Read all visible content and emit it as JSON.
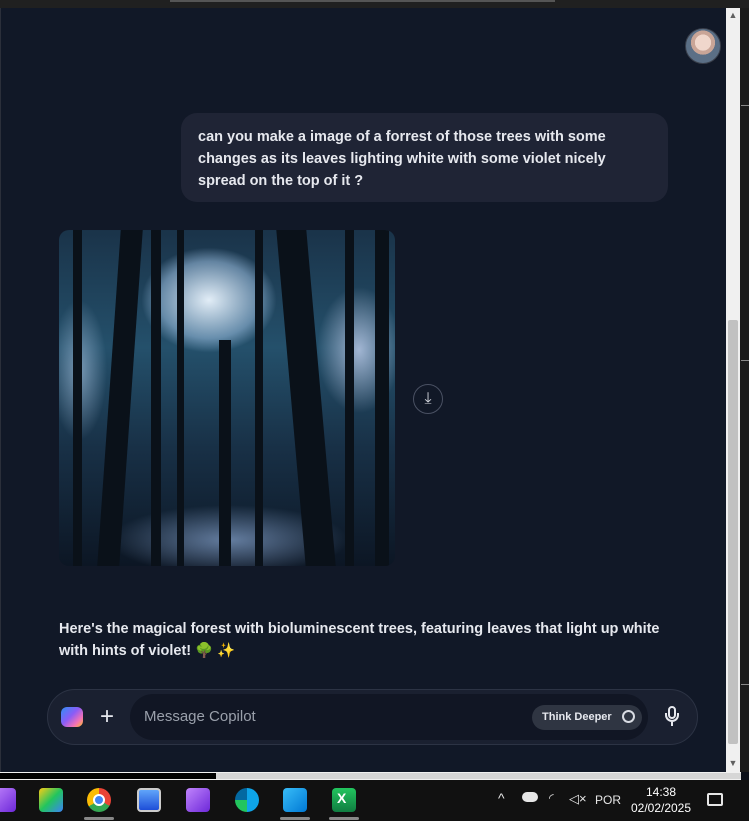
{
  "conversation": {
    "user_message": "can you make a image of a forrest of those trees with some changes as its leaves lighting white with some violet  nicely spread on the top of it ?",
    "assistant_reply": "Here's the magical forest with bioluminescent trees, featuring leaves that light up white with hints of violet! 🌳 ✨",
    "download_icon": "download-icon"
  },
  "composer": {
    "placeholder": "Message Copilot",
    "think_deeper_label": "Think Deeper",
    "icons": [
      "copilot-logo-icon",
      "plus-icon",
      "think-deeper-icon",
      "microphone-icon"
    ]
  },
  "taskbar": {
    "apps": [
      "visual-studio-icon",
      "paint-icon",
      "chrome-icon",
      "remote-desktop-icon",
      "visual-studio-icon",
      "edge-icon",
      "vscode-icon",
      "excel-icon"
    ],
    "tray": {
      "language": "POR",
      "time": "14:38",
      "date": "02/02/2025"
    }
  },
  "colors": {
    "page_bg": "#111827",
    "user_bubble": "#1f2435",
    "composer_bg": "#1a2030",
    "text": "#e6e8ee",
    "taskbar": "#111111"
  }
}
